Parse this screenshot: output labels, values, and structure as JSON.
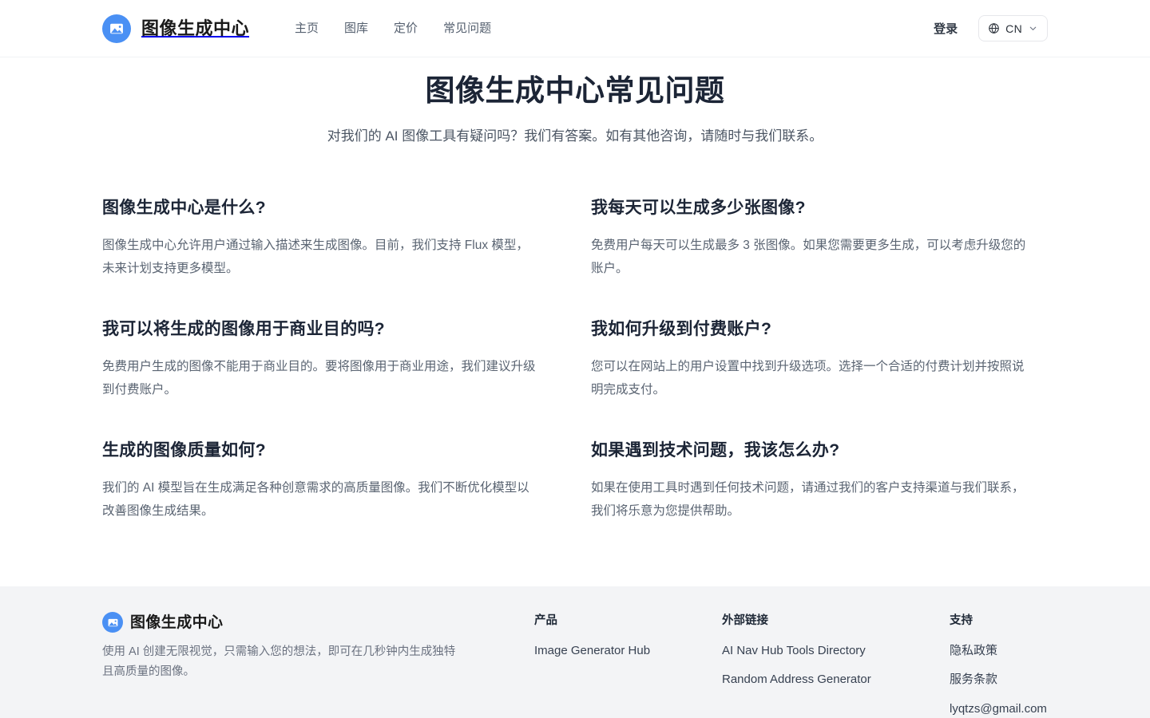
{
  "header": {
    "brand": {
      "name": "图像生成中心",
      "icon": "image-logo-icon",
      "color": "#4a90f4"
    },
    "nav": [
      {
        "label": "主页"
      },
      {
        "label": "图库"
      },
      {
        "label": "定价"
      },
      {
        "label": "常见问题"
      }
    ],
    "login_label": "登录",
    "language": {
      "icon": "globe-icon",
      "code": "CN",
      "chevron": "chevron-down-icon"
    }
  },
  "main": {
    "title": "图像生成中心常见问题",
    "subtitle": "对我们的 AI 图像工具有疑问吗？我们有答案。如有其他咨询，请随时与我们联系。",
    "faqs": [
      {
        "question": "图像生成中心是什么?",
        "answer": "图像生成中心允许用户通过输入描述来生成图像。目前，我们支持 Flux 模型，未来计划支持更多模型。"
      },
      {
        "question": "我每天可以生成多少张图像?",
        "answer": "免费用户每天可以生成最多 3 张图像。如果您需要更多生成，可以考虑升级您的账户。"
      },
      {
        "question": "我可以将生成的图像用于商业目的吗?",
        "answer": "免费用户生成的图像不能用于商业目的。要将图像用于商业用途，我们建议升级到付费账户。"
      },
      {
        "question": "我如何升级到付费账户?",
        "answer": "您可以在网站上的用户设置中找到升级选项。选择一个合适的付费计划并按照说明完成支付。"
      },
      {
        "question": "生成的图像质量如何?",
        "answer": "我们的 AI 模型旨在生成满足各种创意需求的高质量图像。我们不断优化模型以改善图像生成结果。"
      },
      {
        "question": "如果遇到技术问题，我该怎么办?",
        "answer": "如果在使用工具时遇到任何技术问题，请通过我们的客户支持渠道与我们联系，我们将乐意为您提供帮助。"
      }
    ]
  },
  "footer": {
    "brand": {
      "name": "图像生成中心",
      "icon": "image-logo-icon"
    },
    "tagline": "使用 AI 创建无限视觉，只需输入您的想法，即可在几秒钟内生成独特且高质量的图像。",
    "columns": [
      {
        "title": "产品",
        "items": [
          {
            "label": "Image Generator Hub"
          }
        ]
      },
      {
        "title": "外部链接",
        "items": [
          {
            "label": "AI Nav Hub Tools Directory"
          },
          {
            "label": "Random Address Generator"
          }
        ]
      },
      {
        "title": "支持",
        "items": [
          {
            "label": "隐私政策"
          },
          {
            "label": "服务条款"
          },
          {
            "label": "lyqtzs@gmail.com"
          }
        ]
      }
    ]
  }
}
